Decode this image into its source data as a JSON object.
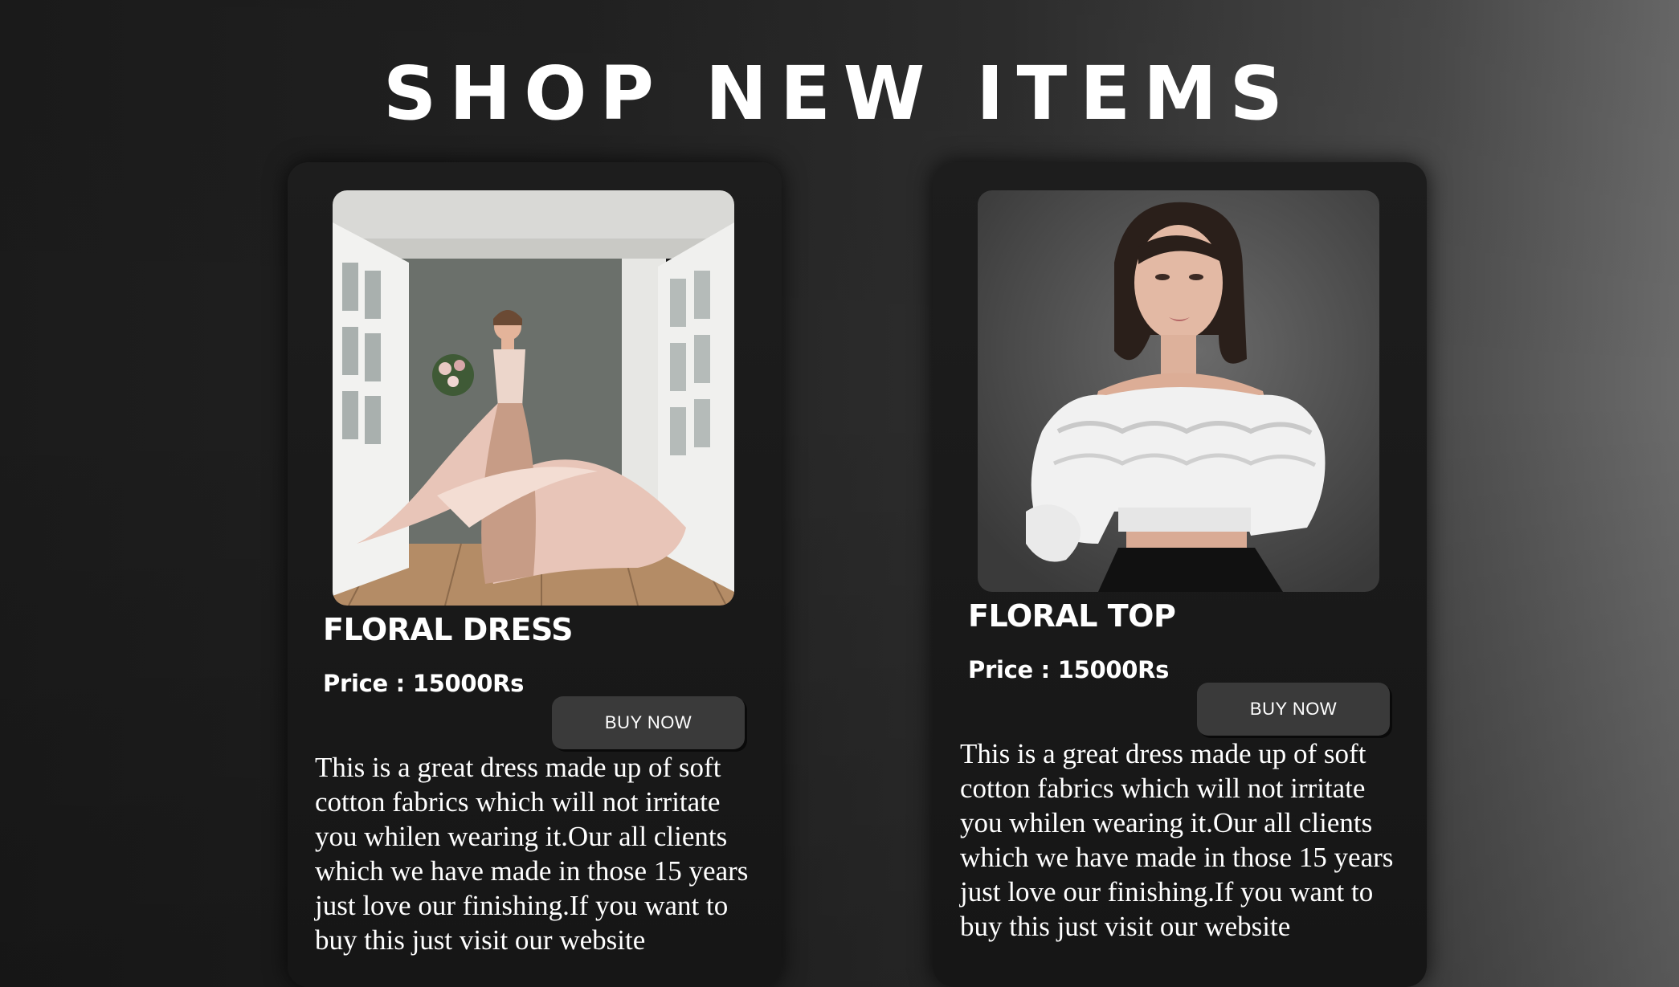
{
  "header": {
    "title": "SHOP NEW ITEMS"
  },
  "products": [
    {
      "name": "FLORAL DRESS",
      "price": "Price : 15000Rs",
      "button_label": "BUY NOW",
      "description": "This is a great dress made up of soft cotton fabrics which will not irritate you whilen wearing it.Our all clients which we have made in those 15 years just love our finishing.If you want to buy this just visit our website"
    },
    {
      "name": "FLORAL TOP",
      "price": "Price : 15000Rs",
      "button_label": "BUY NOW",
      "description": "This is a great dress made up of soft cotton fabrics which will not irritate you whilen wearing it.Our all clients which we have made in those 15 years just love our finishing.If you want to buy this just visit our website"
    }
  ],
  "colors": {
    "background_dark": "#1b1b1b",
    "background_light": "#6b6b6b",
    "card": "#1b1b1b",
    "button": "#3a3a3a",
    "text": "#ffffff"
  }
}
